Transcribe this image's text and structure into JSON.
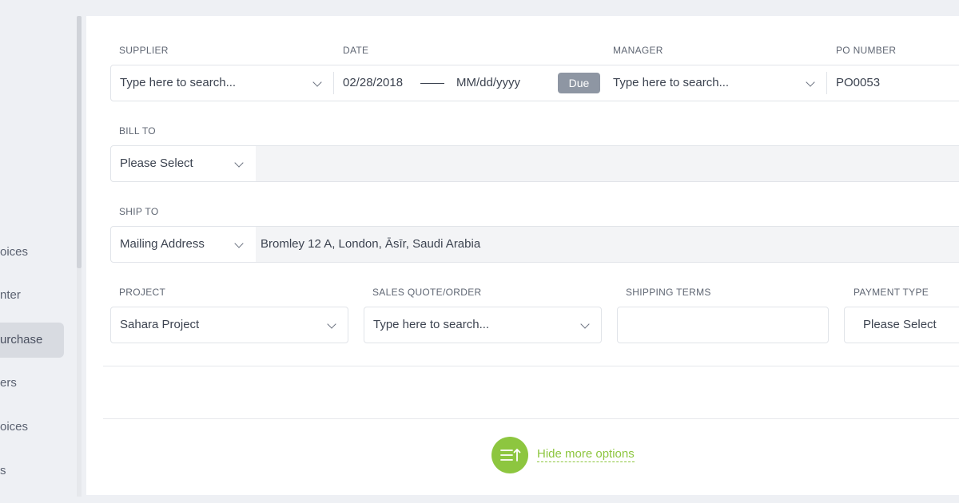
{
  "sidebar": {
    "items": [
      {
        "label": "oices"
      },
      {
        "label": "nter"
      },
      {
        "label": "urchase",
        "active": true
      },
      {
        "label": "ers"
      },
      {
        "label": "oices"
      },
      {
        "label": "s"
      }
    ]
  },
  "form": {
    "supplier": {
      "label": "SUPPLIER",
      "placeholder": "Type here to search..."
    },
    "date": {
      "label": "DATE",
      "start": "02/28/2018",
      "end_placeholder": "MM/dd/yyyy",
      "due_label": "Due"
    },
    "manager": {
      "label": "MANAGER",
      "placeholder": "Type here to search..."
    },
    "po_number": {
      "label": "PO NUMBER",
      "value": "PO0053"
    },
    "bill_to": {
      "label": "BILL TO",
      "select": "Please Select",
      "address": ""
    },
    "ship_to": {
      "label": "SHIP TO",
      "select": "Mailing Address",
      "address": "Bromley 12 A, London, Āsīr, Saudi Arabia"
    },
    "project": {
      "label": "PROJECT",
      "value": "Sahara Project"
    },
    "sales_quote": {
      "label": "SALES QUOTE/ORDER",
      "placeholder": "Type here to search..."
    },
    "shipping_terms": {
      "label": "SHIPPING TERMS",
      "value": ""
    },
    "payment_type": {
      "label": "PAYMENT TYPE",
      "value": "Please Select"
    }
  },
  "more_options": {
    "label": "Hide more options",
    "icon": "collapse-list-icon"
  },
  "colors": {
    "accent": "#8dc63f",
    "due_badge": "#8e96a3"
  }
}
